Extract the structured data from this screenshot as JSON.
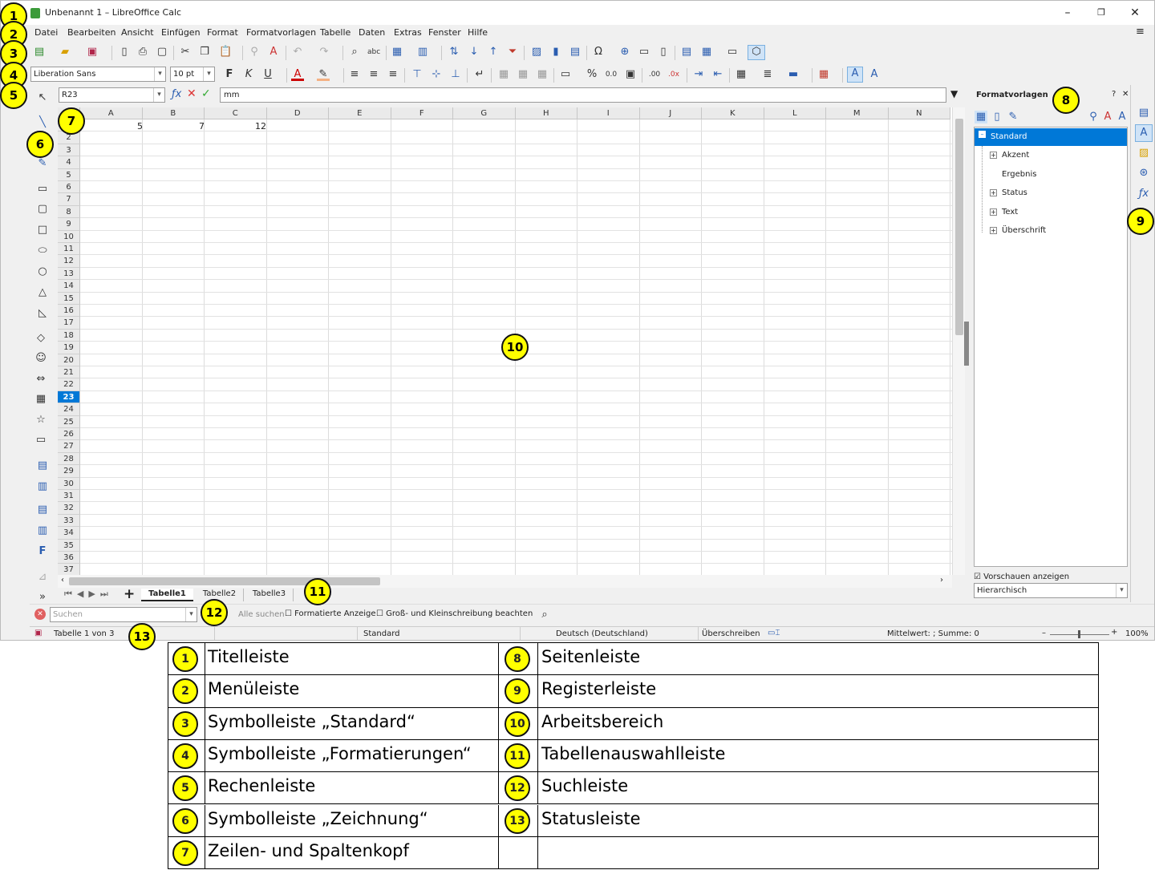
{
  "window": {
    "title": "Unbenannt 1 – LibreOffice Calc"
  },
  "menu": [
    "Datei",
    "Bearbeiten",
    "Ansicht",
    "Einfügen",
    "Format",
    "Formatvorlagen",
    "Tabelle",
    "Daten",
    "Extras",
    "Fenster",
    "Hilfe"
  ],
  "formatting": {
    "font_name": "Liberation Sans",
    "font_size": "10 pt"
  },
  "formula_bar": {
    "name_box": "R23",
    "content": "mm"
  },
  "columns": [
    "A",
    "B",
    "C",
    "D",
    "E",
    "F",
    "G",
    "H",
    "I",
    "J",
    "K",
    "L",
    "M",
    "N"
  ],
  "rows": [
    "1",
    "2",
    "3",
    "4",
    "5",
    "6",
    "7",
    "8",
    "9",
    "10",
    "11",
    "12",
    "13",
    "14",
    "15",
    "16",
    "17",
    "18",
    "19",
    "20",
    "21",
    "22",
    "23",
    "24",
    "25",
    "26",
    "27",
    "28",
    "29",
    "30",
    "31",
    "32",
    "33",
    "34",
    "35",
    "36",
    "37"
  ],
  "active_row": "23",
  "cells": {
    "a1": "5",
    "b1": "7",
    "c1": "12"
  },
  "sidebar": {
    "title": "Formatvorlagen",
    "styles": [
      "Standard",
      "Akzent",
      "Ergebnis",
      "Status",
      "Text",
      "Überschrift"
    ],
    "preview_label": "Vorschauen anzeigen",
    "filter": "Hierarchisch"
  },
  "sheets": {
    "tabs": [
      "Tabelle1",
      "Tabelle2",
      "Tabelle3"
    ],
    "active": "Tabelle1"
  },
  "find": {
    "placeholder": "Suchen",
    "find_all": "Alle suchen",
    "formatted": "Formatierte Anzeige",
    "match_case": "Groß- und Kleinschreibung beachten"
  },
  "status": {
    "sheet": "Tabelle 1 von 3",
    "page_style": "Standard",
    "language": "Deutsch (Deutschland)",
    "mode": "Überschreiben",
    "sum": "Mittelwert: ; Summe: 0",
    "zoom": "100%"
  },
  "legend": [
    {
      "num": "1",
      "label": "Titelleiste"
    },
    {
      "num": "2",
      "label": "Menüleiste"
    },
    {
      "num": "3",
      "label": "Symbolleiste „Standard“"
    },
    {
      "num": "4",
      "label": "Symbolleiste „Formatierungen“"
    },
    {
      "num": "5",
      "label": "Rechenleiste"
    },
    {
      "num": "6",
      "label": "Symbolleiste „Zeichnung“"
    },
    {
      "num": "7",
      "label": "Zeilen- und Spaltenkopf"
    },
    {
      "num": "8",
      "label": "Seitenleiste"
    },
    {
      "num": "9",
      "label": "Registerleiste"
    },
    {
      "num": "10",
      "label": "Arbeitsbereich"
    },
    {
      "num": "11",
      "label": "Tabellenauswahlleiste"
    },
    {
      "num": "12",
      "label": "Suchleiste"
    },
    {
      "num": "13",
      "label": "Statusleiste"
    }
  ],
  "colors": {
    "accent": "#0078d7",
    "badge": "#ffff00"
  }
}
